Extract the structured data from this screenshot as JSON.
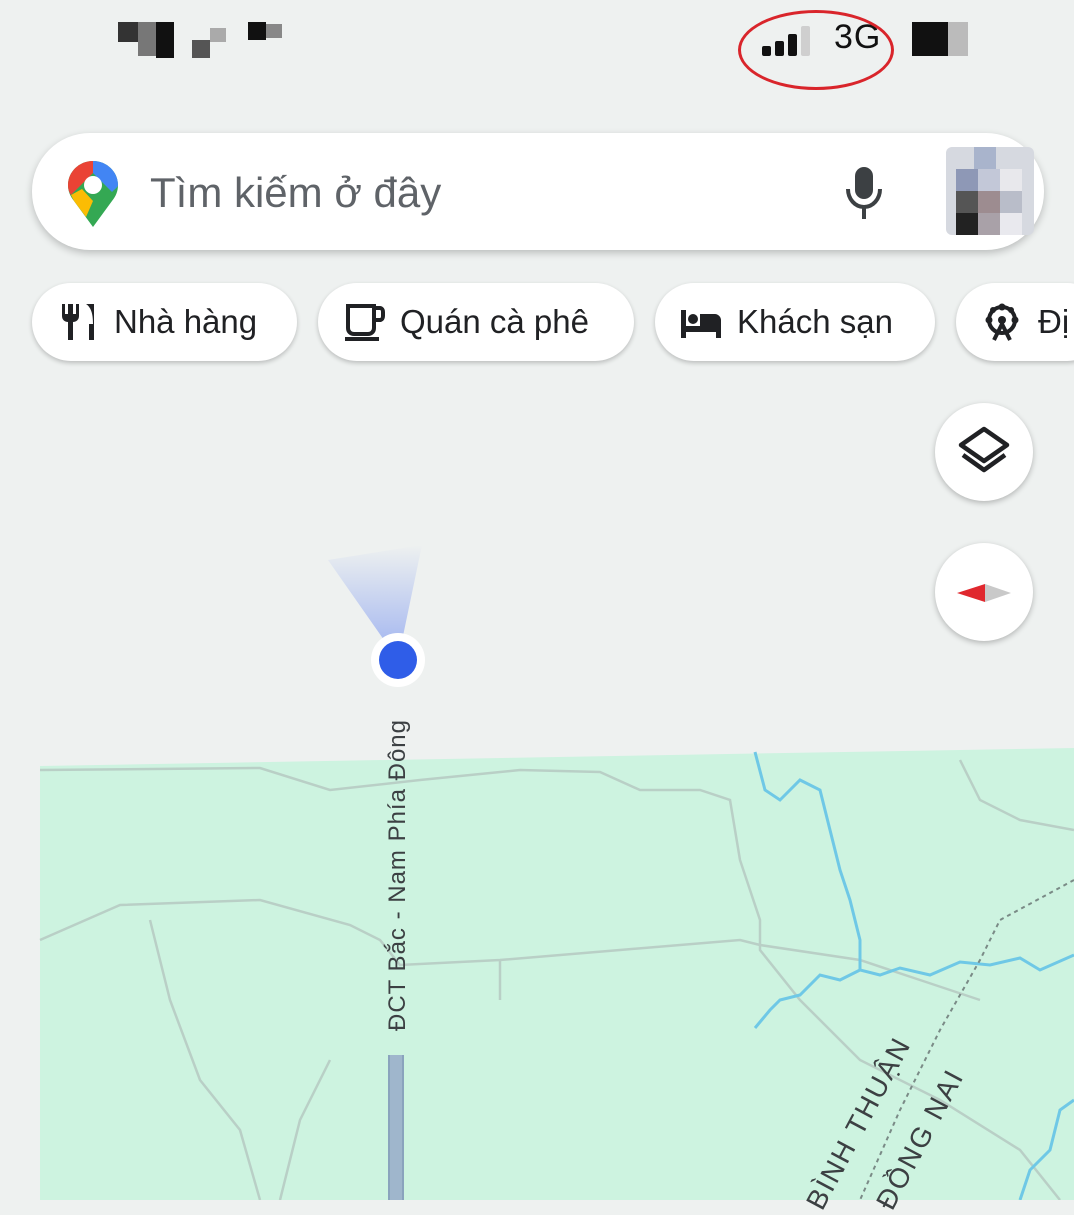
{
  "status_bar": {
    "network_label": "3G",
    "icons": [
      "signal-icon",
      "battery-icon"
    ]
  },
  "search": {
    "placeholder": "Tìm kiếm ở đây",
    "icons": [
      "google-maps-pin-icon",
      "microphone-icon",
      "profile-avatar"
    ]
  },
  "chips": [
    {
      "label": "Nhà hàng",
      "icon": "restaurant-icon"
    },
    {
      "label": "Quán cà phê",
      "icon": "coffee-icon"
    },
    {
      "label": "Khách sạn",
      "icon": "hotel-bed-icon"
    },
    {
      "label": "Đị",
      "icon": "attraction-icon"
    }
  ],
  "map_controls": {
    "layers_icon": "layers-icon",
    "compass_icon": "compass-icon"
  },
  "map": {
    "road_label": "ĐCT Bắc - Nam Phía Đông",
    "province_labels": [
      "BÌNH THUẬN",
      "ĐỒNG NAI"
    ],
    "colors": {
      "background": "#eef1f0",
      "land": "#cdf3e0",
      "river": "#6fc8e6",
      "road": "#8aa3bd",
      "location_dot": "#2f5de8",
      "annotation_circle": "#d9252b"
    }
  }
}
